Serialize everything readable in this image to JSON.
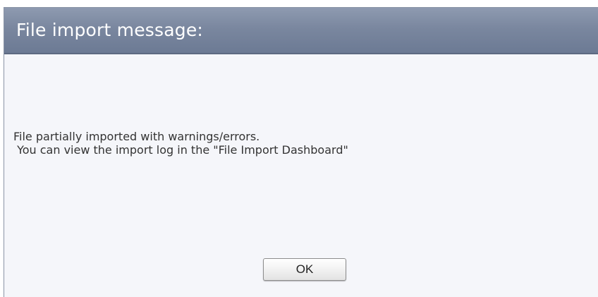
{
  "dialog": {
    "title": "File import message:",
    "message_line1": "File partially imported with warnings/errors.",
    "message_line2": " You can view the import log in the \"File Import Dashboard\"",
    "ok_label": "OK"
  },
  "colors": {
    "title_bar": "#7a879f",
    "body_background": "#f5f6fa",
    "title_text": "#ffffff",
    "message_text": "#333333"
  }
}
